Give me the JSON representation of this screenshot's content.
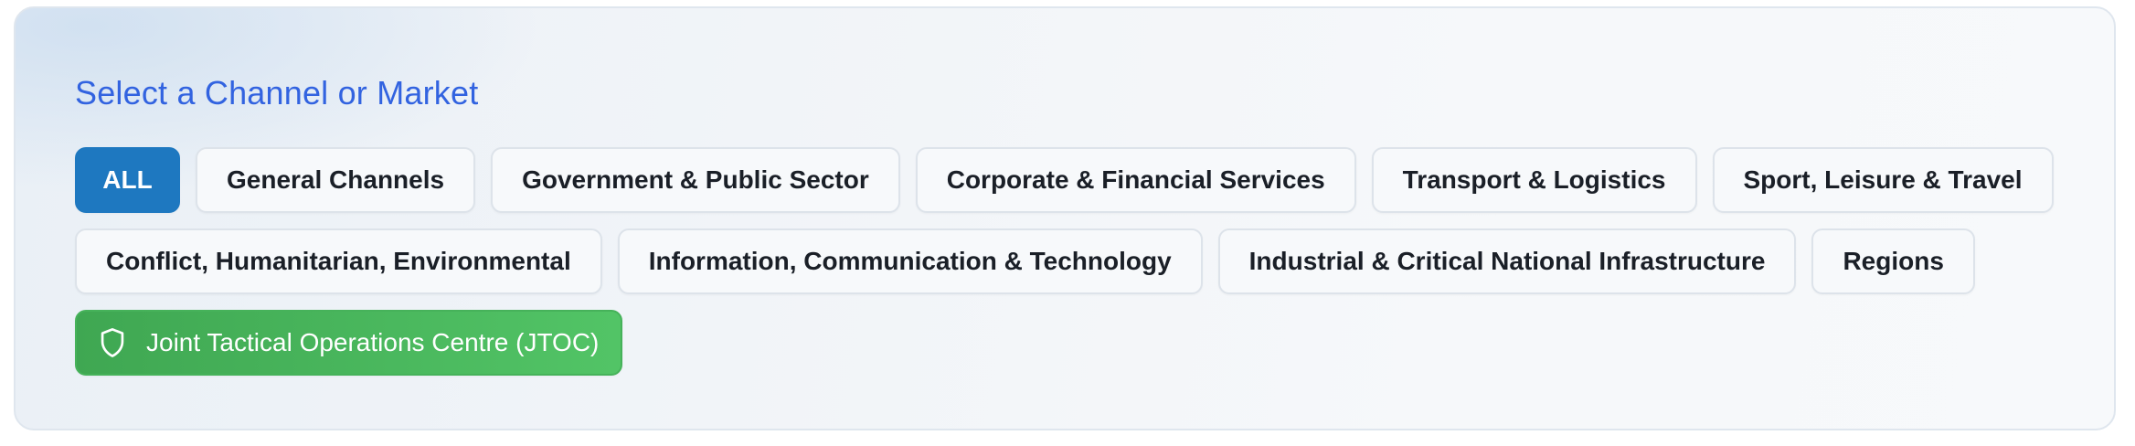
{
  "panel": {
    "title": "Select a Channel or Market"
  },
  "filters": {
    "row1": [
      {
        "label": "ALL",
        "active": true
      },
      {
        "label": "General Channels"
      },
      {
        "label": "Government & Public Sector"
      },
      {
        "label": "Corporate & Financial Services"
      },
      {
        "label": "Transport & Logistics"
      },
      {
        "label": "Sport, Leisure & Travel"
      }
    ],
    "row2": [
      {
        "label": "Conflict, Humanitarian, Environmental"
      },
      {
        "label": "Information, Communication & Technology"
      },
      {
        "label": "Industrial & Critical National Infrastructure"
      },
      {
        "label": "Regions"
      }
    ],
    "jtoc": {
      "label": "Joint Tactical Operations Centre (JTOC)",
      "icon": "shield-icon"
    }
  },
  "colors": {
    "title": "#3263e0",
    "active_chip": "#1e78c0",
    "jtoc_start": "#3fa752",
    "jtoc_end": "#52c466"
  }
}
